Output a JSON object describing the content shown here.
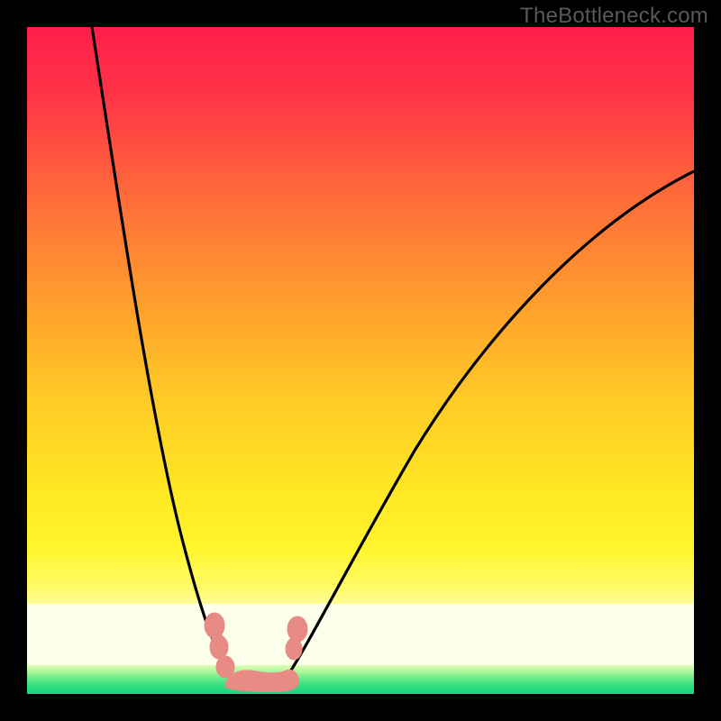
{
  "watermark": "TheBottleneck.com",
  "colors": {
    "frame": "#000000",
    "gradient_top": "#ff1f4a",
    "gradient_mid": "#ffe824",
    "gradient_pale": "#fcffea",
    "gradient_green": "#18d77f",
    "curve": "#000000",
    "markers": "#e88b85",
    "watermark": "#58595b"
  },
  "chart_data": {
    "type": "line",
    "title": "",
    "xlabel": "",
    "ylabel": "",
    "xlim": [
      0,
      100
    ],
    "ylim": [
      0,
      100
    ],
    "note": "Axes are unlabeled in the source image; x and y are normalized 0–100 across the plotting rectangle (origin at lower-left). Values are visual estimates.",
    "series": [
      {
        "name": "left-branch",
        "x": [
          10,
          14,
          18,
          22,
          26,
          30,
          31
        ],
        "y": [
          100,
          75,
          50,
          28,
          12,
          3,
          2
        ]
      },
      {
        "name": "right-branch",
        "x": [
          38,
          42,
          50,
          58,
          66,
          76,
          88,
          100
        ],
        "y": [
          2,
          8,
          22,
          36,
          50,
          63,
          74,
          79
        ]
      },
      {
        "name": "marker-cluster",
        "x": [
          28,
          29,
          30,
          31,
          33,
          35,
          37,
          39,
          40,
          41
        ],
        "y": [
          10,
          7,
          4,
          2,
          1.5,
          1.5,
          2,
          4,
          7,
          10
        ]
      }
    ],
    "background_bands_y": {
      "red_to_yellow": [
        20,
        100
      ],
      "pale": [
        5,
        14
      ],
      "green": [
        0,
        5
      ]
    }
  }
}
